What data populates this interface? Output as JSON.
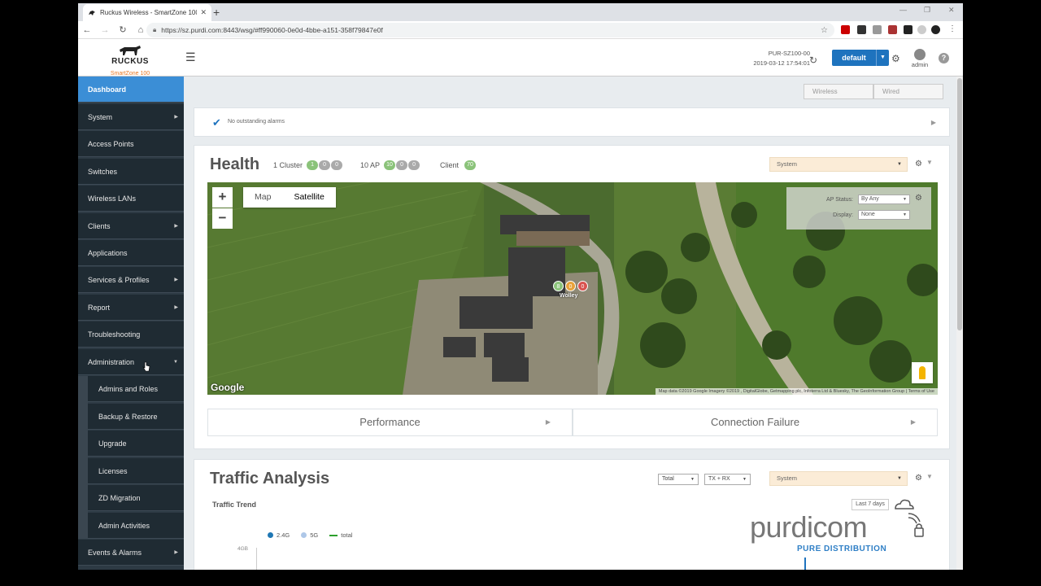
{
  "browser": {
    "tab_title": "Ruckus Wireless - SmartZone 100",
    "url": "https://sz.purdi.com:8443/wsg/#ff990060-0e0d-4bbe-a151-358f79847e0f"
  },
  "header": {
    "brand": "RUCKUS",
    "product": "SmartZone 100",
    "hostname": "PUR-SZ100-00",
    "datetime": "2019-03-12  17:54:01",
    "domain": "default",
    "user": "admin"
  },
  "sidebar": {
    "items": [
      {
        "label": "Dashboard"
      },
      {
        "label": "System"
      },
      {
        "label": "Access Points"
      },
      {
        "label": "Switches"
      },
      {
        "label": "Wireless LANs"
      },
      {
        "label": "Clients"
      },
      {
        "label": "Applications"
      },
      {
        "label": "Services & Profiles"
      },
      {
        "label": "Report"
      },
      {
        "label": "Troubleshooting"
      },
      {
        "label": "Administration"
      },
      {
        "label": "Admins and Roles"
      },
      {
        "label": "Backup & Restore"
      },
      {
        "label": "Upgrade"
      },
      {
        "label": "Licenses"
      },
      {
        "label": "ZD Migration"
      },
      {
        "label": "Admin Activities"
      },
      {
        "label": "Events & Alarms"
      }
    ]
  },
  "toggles": {
    "wireless": "Wireless",
    "wired": "Wired"
  },
  "alarms": {
    "text": "No outstanding alarms"
  },
  "health": {
    "title": "Health",
    "cluster_label": "1 Cluster",
    "cluster_counts": [
      "1",
      "0",
      "0"
    ],
    "ap_label": "10 AP",
    "ap_counts": [
      "10",
      "0",
      "0"
    ],
    "client_label": "Client",
    "client_count": "70",
    "scope": "System",
    "map": {
      "map_label": "Map",
      "satellite_label": "Satellite",
      "ap_status_label": "AP Status:",
      "ap_status_value": "By Any",
      "display_label": "Display:",
      "display_value": "None",
      "marker_counts": [
        "8",
        "0",
        "0"
      ],
      "marker_label": "Wolley",
      "google": "Google",
      "attribution": "Map data ©2019 Google Imagery ©2019 , DigitalGlobe, Getmapping plc, Infoterra Ltd & Bluesky, The GeoInformation Group  |  Terms of Use"
    },
    "performance": "Performance",
    "connection_failure": "Connection Failure"
  },
  "traffic": {
    "title": "Traffic Analysis",
    "filter1": "Total",
    "filter2": "TX + RX",
    "scope": "System",
    "trend": "Traffic Trend",
    "range": "Last 7 days",
    "legend": [
      {
        "name": "2.4G",
        "color": "#1f77b4"
      },
      {
        "name": "5G",
        "color": "#aec7e8"
      },
      {
        "name": "total",
        "color": "#2ca02c"
      }
    ],
    "ytick": "4GB"
  },
  "watermark": {
    "name": "purdicom",
    "tagline": "PURE DISTRIBUTION"
  }
}
